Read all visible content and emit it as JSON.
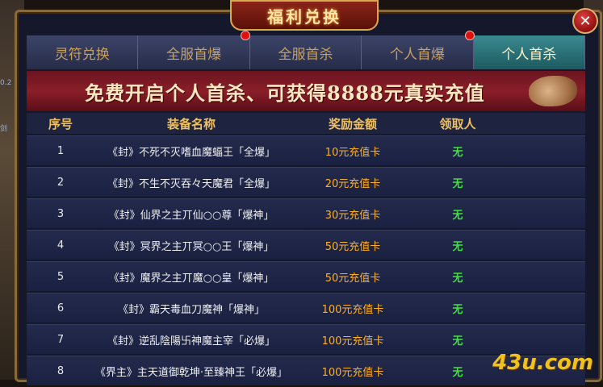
{
  "window": {
    "title": "福利兑换",
    "close_label": "✕"
  },
  "side": {
    "left_a": "0.2",
    "left_b": "剑"
  },
  "tabs": [
    {
      "label": "灵符兑换",
      "active": false
    },
    {
      "label": "全服首爆",
      "active": false
    },
    {
      "label": "全服首杀",
      "active": false
    },
    {
      "label": "个人首爆",
      "active": false
    },
    {
      "label": "个人首杀",
      "active": true
    }
  ],
  "banner": {
    "text": "免费开启个人首杀、可获得8888元真实充值"
  },
  "table": {
    "headers": [
      "序号",
      "装备名称",
      "奖励金额",
      "领取人"
    ],
    "rows": [
      {
        "no": "1",
        "name": "《封》不死不灭嗜血魔蝠王「全爆」",
        "reward": "10元充值卡",
        "claimer": "无"
      },
      {
        "no": "2",
        "name": "《封》不生不灭吞々天魔君「全爆」",
        "reward": "20元充值卡",
        "claimer": "无"
      },
      {
        "no": "3",
        "name": "《封》仙界之主丌仙○○尊「爆神」",
        "reward": "30元充值卡",
        "claimer": "无"
      },
      {
        "no": "4",
        "name": "《封》冥界之主丌冥○○王「爆神」",
        "reward": "50元充值卡",
        "claimer": "无"
      },
      {
        "no": "5",
        "name": "《封》魔界之主丌魔○○皇「爆神」",
        "reward": "50元充值卡",
        "claimer": "无"
      },
      {
        "no": "6",
        "name": "《封》霸天毒血刀魔神「爆神」",
        "reward": "100元充值卡",
        "claimer": "无"
      },
      {
        "no": "7",
        "name": "《封》逆乱陰陽卐神魔主宰「必爆」",
        "reward": "100元充值卡",
        "claimer": "无"
      },
      {
        "no": "8",
        "name": "《界主》主天道御乾坤·至臻神王「必爆」",
        "reward": "100元充值卡",
        "claimer": "无"
      }
    ]
  },
  "watermark": "43u.com"
}
